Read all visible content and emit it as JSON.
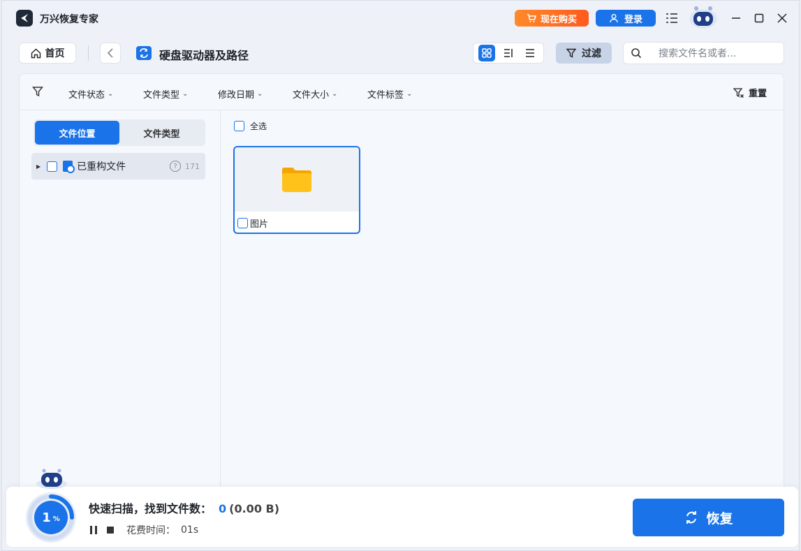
{
  "app": {
    "title": "万兴恢复专家",
    "buy_label": "现在购买",
    "login_label": "登录"
  },
  "nav": {
    "home_label": "首页",
    "path_title": "硬盘驱动器及路径",
    "filter_label": "过滤",
    "search_placeholder": "搜索文件名或者..."
  },
  "filters": {
    "items": [
      "文件状态",
      "文件类型",
      "修改日期",
      "文件大小",
      "文件标签"
    ],
    "reset_label": "重置"
  },
  "sidebar": {
    "tabs": [
      {
        "label": "文件位置",
        "active": true
      },
      {
        "label": "文件类型",
        "active": false
      }
    ],
    "tree": [
      {
        "label": "已重构文件",
        "count": "171"
      }
    ]
  },
  "content": {
    "select_all_label": "全选",
    "items": [
      {
        "name": "图片",
        "icon": "folder-icon"
      }
    ]
  },
  "scan": {
    "progress_value": "1",
    "progress_unit": "%",
    "status_text": "快速扫描，找到文件数：",
    "found_count": "0",
    "found_size": "(0.00 B)",
    "time_label": "花费时间：",
    "time_value": "01s",
    "recover_label": "恢复"
  },
  "colors": {
    "accent": "#1a73e8",
    "buy_gradient_start": "#ff8a2a",
    "buy_gradient_end": "#ff5a1f",
    "folder": "#ffb400"
  }
}
